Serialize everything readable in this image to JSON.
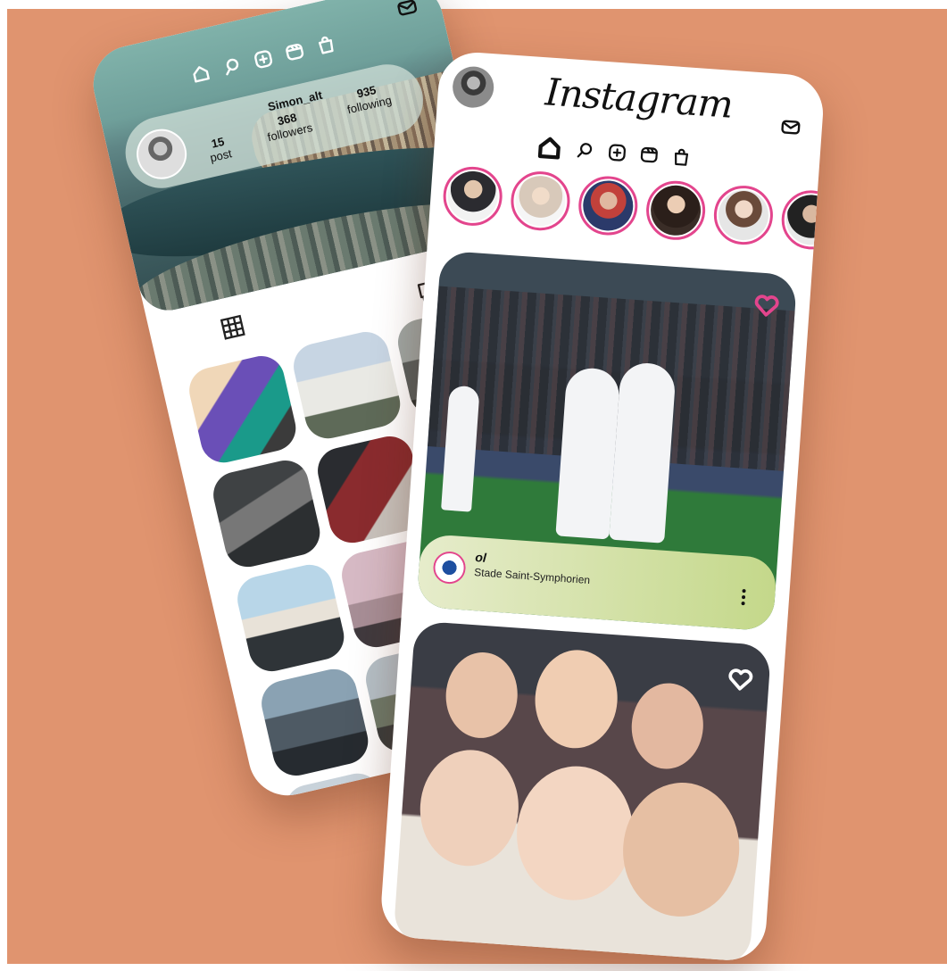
{
  "colors": {
    "background": "#e0946f",
    "story_ring": "#e3458d",
    "caption_gradient_start": "#e6eccb",
    "caption_gradient_end": "#c4d88a"
  },
  "profile": {
    "username": "Simon_alt",
    "stats": [
      {
        "value": "15",
        "label": "post"
      },
      {
        "value": "368",
        "label": "followers"
      },
      {
        "value": "935",
        "label": "following"
      }
    ],
    "nav_icons": [
      "home-icon",
      "search-icon",
      "add-icon",
      "reels-icon",
      "shop-icon"
    ],
    "mail_icon": "mail-icon",
    "grid_icon": "grid-icon",
    "comment_icon": "comment-icon"
  },
  "feed": {
    "app_title": "Instagram",
    "nav_icons": [
      "home-icon",
      "search-icon",
      "add-icon",
      "reels-icon",
      "shop-icon"
    ],
    "mail_icon": "mail-icon",
    "stories_count": 6,
    "posts": [
      {
        "account": "ol",
        "location": "Stade Saint-Symphorien",
        "like_icon": "heart-icon"
      },
      {
        "like_icon": "heart-icon"
      }
    ]
  }
}
